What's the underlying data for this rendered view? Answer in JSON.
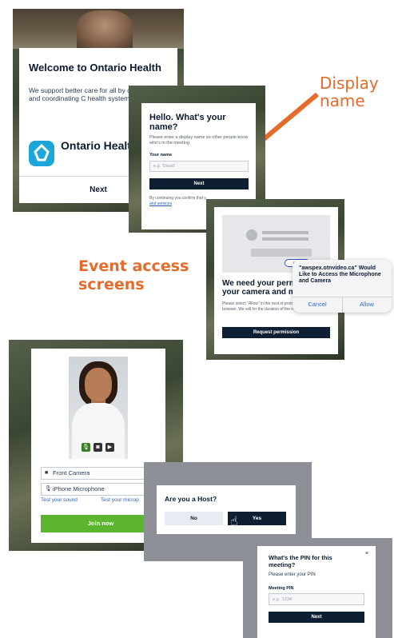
{
  "annotations": {
    "display_name": "Display name",
    "event_access": "Event access screens"
  },
  "welcome_screen": {
    "title": "Welcome to Ontario Health",
    "description": "We support better care for all by connecting and coordinating C health system.",
    "logo_text": "Ontario Health",
    "logo_icon": "ontario-trillium-icon",
    "next_label": "Next"
  },
  "name_screen": {
    "title": "Hello. What's your name?",
    "description": "Please enter a display name so other people know who's in the meeting",
    "field_label": "Your name",
    "placeholder": "e.g. 'David'",
    "next_label": "Next",
    "consent_text": "By continuing you confirm that y",
    "consent_link": "and services"
  },
  "permission_screen": {
    "illustration_allow": "Allow",
    "title": "We need your permiss your camera and micr",
    "description": "Please select \"Allow\" in the next st prompted by your browser. We will for the duration of the meeting.",
    "request_label": "Request permission",
    "dialog": {
      "title": "\"awspex.otnvideo.ca\" Would Like to Access the Microphone and Camera",
      "cancel_label": "Cancel",
      "allow_label": "Allow"
    }
  },
  "device_screen": {
    "camera_option": "Front Camera",
    "microphone_option": "iPhone Microphone",
    "test_sound_label": "Test your sound",
    "test_mic_label": "Test your microp",
    "join_label": "Join now",
    "colors": {
      "join": "#5bb52f"
    }
  },
  "host_screen": {
    "title": "Are you a Host?",
    "no_label": "No",
    "yes_label": "Yes"
  },
  "pin_screen": {
    "title": "What's the PIN for this meeting?",
    "close_glyph": "×",
    "description": "Please enter your PIN",
    "field_label": "Meeting PIN",
    "placeholder": "e.g. '1234'",
    "next_label": "Next"
  },
  "colors": {
    "accent": "#e36c2d",
    "navy": "#0f1f33",
    "link": "#2a5fb0",
    "ios_blue": "#1a6cf0"
  }
}
